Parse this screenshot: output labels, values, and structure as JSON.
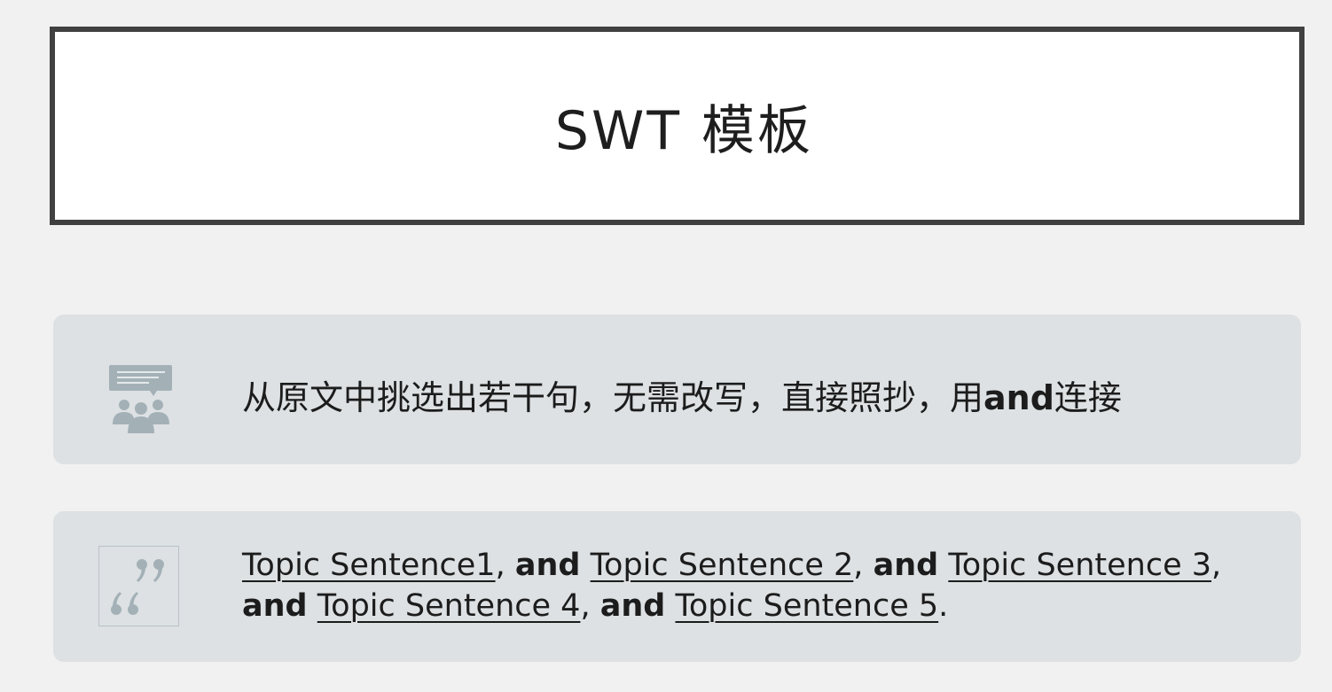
{
  "title": "SWT 模板",
  "card1": {
    "icon": "presentation-audience-icon",
    "text_before": "从原文中挑选出若干句，无需改写，直接照抄，用",
    "text_bold": "and",
    "text_after": "连接"
  },
  "card2": {
    "icon": "quote-icon",
    "topics": [
      "Topic Sentence1",
      "Topic Sentence 2",
      "Topic Sentence 3",
      "Topic Sentence 4",
      "Topic Sentence 5"
    ],
    "connector": "and",
    "comma": ",",
    "period": "."
  },
  "colors": {
    "background": "#f1f1f1",
    "card": "#dde1e3",
    "icon": "#a3b1b7",
    "title_border": "#404040"
  }
}
